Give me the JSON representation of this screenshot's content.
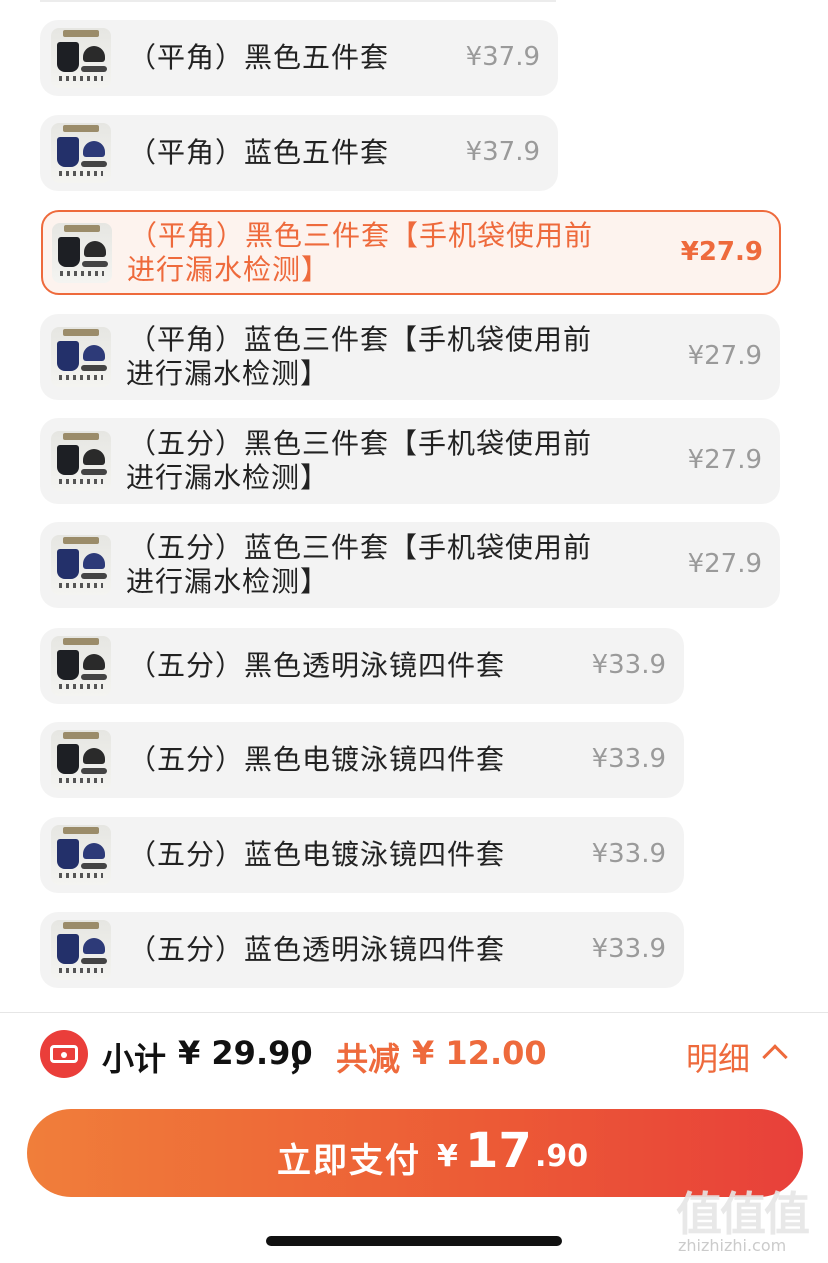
{
  "options": [
    {
      "label_lines": [
        "（平角）黑色五件套"
      ],
      "price": "¥37.9",
      "variant": "black",
      "selected": false
    },
    {
      "label_lines": [
        "（平角）蓝色五件套"
      ],
      "price": "¥37.9",
      "variant": "blue",
      "selected": false
    },
    {
      "label_lines": [
        "（平角）黑色三件套【手机袋使用前",
        "进行漏水检测】"
      ],
      "price": "¥27.9",
      "variant": "black",
      "selected": true
    },
    {
      "label_lines": [
        "（平角）蓝色三件套【手机袋使用前",
        "进行漏水检测】"
      ],
      "price": "¥27.9",
      "variant": "blue",
      "selected": false
    },
    {
      "label_lines": [
        "（五分）黑色三件套【手机袋使用前",
        "进行漏水检测】"
      ],
      "price": "¥27.9",
      "variant": "black",
      "selected": false
    },
    {
      "label_lines": [
        "（五分）蓝色三件套【手机袋使用前",
        "进行漏水检测】"
      ],
      "price": "¥27.9",
      "variant": "blue",
      "selected": false
    },
    {
      "label_lines": [
        "（五分）黑色透明泳镜四件套"
      ],
      "price": "¥33.9",
      "variant": "black",
      "selected": false
    },
    {
      "label_lines": [
        "（五分）黑色电镀泳镜四件套"
      ],
      "price": "¥33.9",
      "variant": "black",
      "selected": false
    },
    {
      "label_lines": [
        "（五分）蓝色电镀泳镜四件套"
      ],
      "price": "¥33.9",
      "variant": "blue",
      "selected": false
    },
    {
      "label_lines": [
        "（五分）蓝色透明泳镜四件套"
      ],
      "price": "¥33.9",
      "variant": "blue",
      "selected": false
    }
  ],
  "summary": {
    "subtotal_label": "小计",
    "subtotal_value": "¥ 29.90",
    "separator": "，",
    "discount_label": "共减",
    "discount_value": "¥ 12.00",
    "detail_label": "明细"
  },
  "pay_button": {
    "label": "立即支付",
    "currency": "¥",
    "amount_int": "17",
    "amount_dec": ".90"
  },
  "watermark": {
    "glyphs": "值值值",
    "url": "zhizhizhi.com"
  },
  "colors": {
    "accent": "#ee6a3c",
    "selected_bg": "#fdf3ee",
    "option_bg": "#f3f3f3",
    "coupon_red": "#ea3e3a"
  },
  "icons": [
    "coupon-icon",
    "chevron-up-icon"
  ]
}
